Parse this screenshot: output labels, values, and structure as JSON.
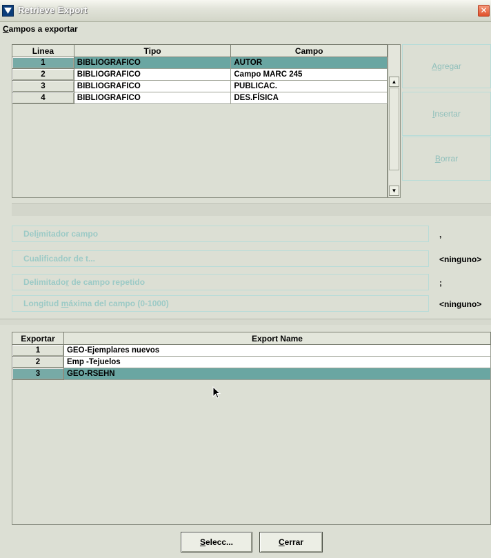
{
  "window": {
    "title": "Retrieve Export",
    "close_glyph": "✕"
  },
  "fields_section": {
    "label": "Campos a exportar",
    "columns": [
      "Linea",
      "Tipo",
      "Campo"
    ],
    "rows": [
      {
        "linea": "1",
        "tipo": "BIBLIOGRAFICO",
        "campo": "AUTOR",
        "selected": true
      },
      {
        "linea": "2",
        "tipo": "BIBLIOGRAFICO",
        "campo": "Campo MARC 245",
        "selected": false
      },
      {
        "linea": "3",
        "tipo": "BIBLIOGRAFICO",
        "campo": "PUBLICAC.",
        "selected": false
      },
      {
        "linea": "4",
        "tipo": "BIBLIOGRAFICO",
        "campo": "DES.FÍSICA",
        "selected": false
      }
    ]
  },
  "side_buttons": {
    "agregar": {
      "first": "A",
      "rest": "gregar"
    },
    "insertar": {
      "first": "I",
      "rest": "nsertar"
    },
    "borrar": {
      "first": "B",
      "rest": "orrar"
    }
  },
  "options": {
    "delimitador_campo": {
      "pre": "Del",
      "u": "i",
      "post": "mitador campo",
      "value": ","
    },
    "cualificador": {
      "label": "Cualificador de t...",
      "value": "<ninguno>"
    },
    "delimitador_repetido": {
      "pre": "Delimitado",
      "u": "r",
      "post": " de campo repetido",
      "value": ";"
    },
    "longitud": {
      "pre": "Longitud ",
      "u": "m",
      "post": "áxima del campo (0-1000)",
      "value": "<ninguno>"
    }
  },
  "exports_section": {
    "columns": [
      "Exportar",
      "Export Name"
    ],
    "rows": [
      {
        "num": "1",
        "name": "GEO-Ejemplares nuevos",
        "selected": false
      },
      {
        "num": "2",
        "name": "Emp -Tejuelos",
        "selected": false
      },
      {
        "num": "3",
        "name": "GEO-RSEHN",
        "selected": true
      }
    ]
  },
  "buttons": {
    "selecc": {
      "first": "S",
      "rest": "elecc..."
    },
    "cerrar": {
      "first": "C",
      "rest": "errar"
    }
  },
  "colors": {
    "selection": "#6aa6a2",
    "disabled_text": "#9ccac6",
    "window_bg": "#dcdfd4"
  }
}
